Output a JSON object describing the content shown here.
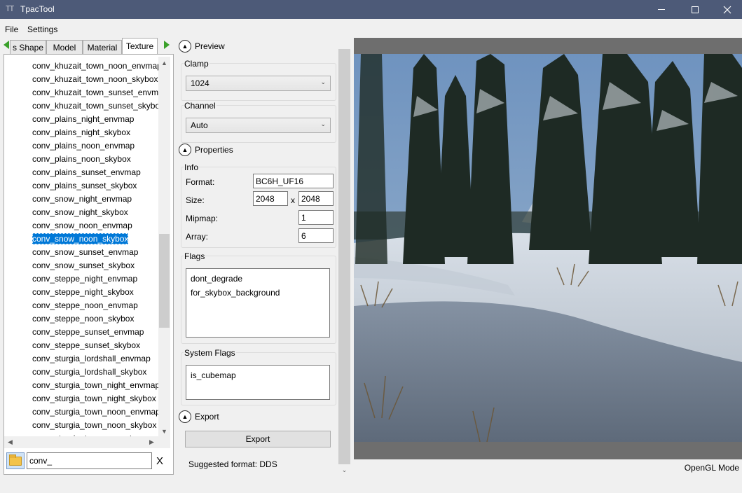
{
  "window": {
    "title": "TpacTool",
    "icon": "app-icon-tt"
  },
  "menu": [
    "File",
    "Settings"
  ],
  "tabs": [
    "s Shape",
    "Model",
    "Material",
    "Texture"
  ],
  "active_tab": "Texture",
  "file_list": {
    "items": [
      "conv_khuzait_town_noon_envmap",
      "conv_khuzait_town_noon_skybox",
      "conv_khuzait_town_sunset_envmap",
      "conv_khuzait_town_sunset_skybox",
      "conv_plains_night_envmap",
      "conv_plains_night_skybox",
      "conv_plains_noon_envmap",
      "conv_plains_noon_skybox",
      "conv_plains_sunset_envmap",
      "conv_plains_sunset_skybox",
      "conv_snow_night_envmap",
      "conv_snow_night_skybox",
      "conv_snow_noon_envmap",
      "conv_snow_noon_skybox",
      "conv_snow_sunset_envmap",
      "conv_snow_sunset_skybox",
      "conv_steppe_night_envmap",
      "conv_steppe_night_skybox",
      "conv_steppe_noon_envmap",
      "conv_steppe_noon_skybox",
      "conv_steppe_sunset_envmap",
      "conv_steppe_sunset_skybox",
      "conv_sturgia_lordshall_envmap",
      "conv_sturgia_lordshall_skybox",
      "conv_sturgia_town_night_envmap",
      "conv_sturgia_town_night_skybox",
      "conv_sturgia_town_noon_envmap",
      "conv_sturgia_town_noon_skybox",
      "conv_sturgia_town_sunset_envmap"
    ],
    "selected_index": 13
  },
  "search": {
    "value": "conv_",
    "clear_label": "X"
  },
  "preview_section": {
    "title": "Preview",
    "clamp": {
      "label": "Clamp",
      "value": "1024"
    },
    "channel": {
      "label": "Channel",
      "value": "Auto"
    }
  },
  "properties_section": {
    "title": "Properties",
    "info_label": "Info",
    "format": {
      "label": "Format:",
      "value": "BC6H_UF16"
    },
    "size": {
      "label": "Size:",
      "width": "2048",
      "separator": "x",
      "height": "2048"
    },
    "mipmap": {
      "label": "Mipmap:",
      "value": "1"
    },
    "array": {
      "label": "Array:",
      "value": "6"
    },
    "flags": {
      "label": "Flags",
      "items": [
        "dont_degrade",
        "for_skybox_background"
      ]
    },
    "system_flags": {
      "label": "System Flags",
      "items": [
        "is_cubemap"
      ]
    }
  },
  "export_section": {
    "title": "Export",
    "button": "Export",
    "suggested": "Suggested format: DDS"
  },
  "status": {
    "mode": "OpenGL Mode"
  },
  "colors": {
    "titlebar": "#4d5a78",
    "selection": "#0078d7",
    "nav_arrow": "#3aa02a"
  }
}
